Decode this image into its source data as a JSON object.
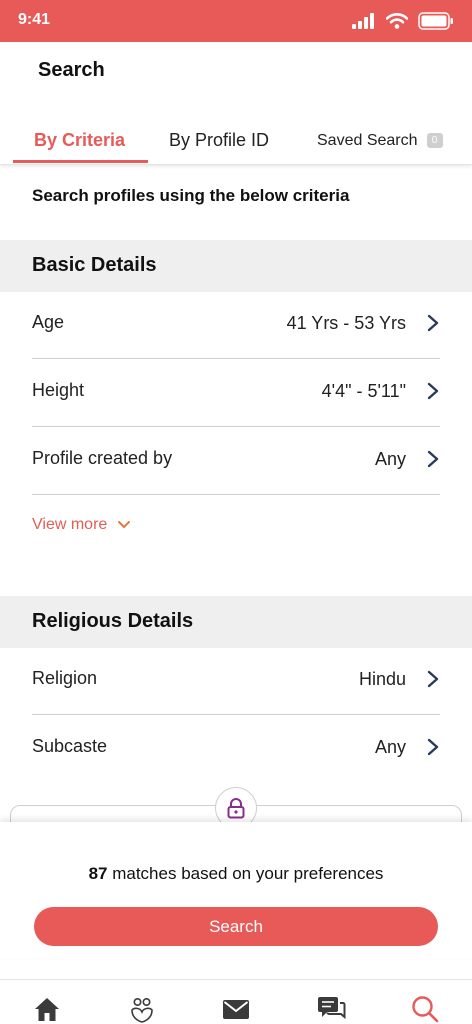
{
  "status_bar": {
    "time": "9:41"
  },
  "header": {
    "title": "Search"
  },
  "tabs": [
    {
      "label": "By Criteria",
      "active": true
    },
    {
      "label": "By Profile ID",
      "active": false
    },
    {
      "label": "Saved Search",
      "badge": "0",
      "active": false
    }
  ],
  "intro": "Search profiles using the below criteria",
  "basic_details": {
    "title": "Basic Details",
    "rows": [
      {
        "label": "Age",
        "value": "41 Yrs - 53 Yrs"
      },
      {
        "label": "Height",
        "value": "4'4\" - 5'11\""
      },
      {
        "label": "Profile created by",
        "value": "Any"
      }
    ],
    "view_more": "View more"
  },
  "religious_details": {
    "title": "Religious Details",
    "rows": [
      {
        "label": "Religion",
        "value": "Hindu"
      },
      {
        "label": "Subcaste",
        "value": "Any"
      }
    ]
  },
  "results": {
    "match_count": "87",
    "match_text": "matches based on your preferences",
    "search_label": "Search"
  },
  "colors": {
    "accent": "#e85a58",
    "section_bg": "#efefef",
    "lock_purple": "#8b2d8b"
  },
  "bottom_nav": [
    "home-icon",
    "matches-icon",
    "mail-icon",
    "chat-icon",
    "search-icon"
  ]
}
